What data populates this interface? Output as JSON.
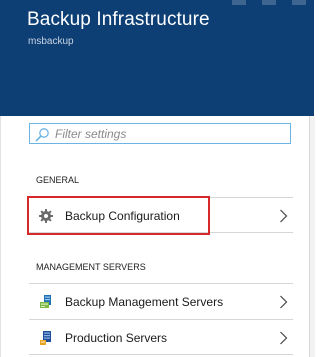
{
  "header": {
    "title": "Backup Infrastructure",
    "subtitle": "msbackup"
  },
  "search": {
    "placeholder": "Filter settings",
    "value": ""
  },
  "sections": {
    "general": {
      "label": "GENERAL",
      "items": [
        {
          "label": "Backup Configuration",
          "icon": "gear-icon"
        }
      ]
    },
    "management_servers": {
      "label": "MANAGEMENT SERVERS",
      "items": [
        {
          "label": "Backup Management Servers",
          "icon": "backup-server-icon"
        },
        {
          "label": "Production Servers",
          "icon": "production-server-icon"
        }
      ]
    }
  },
  "colors": {
    "header_bg": "#0d3f75",
    "search_border": "#6cb5e3",
    "highlight_border": "#d62a2a"
  }
}
